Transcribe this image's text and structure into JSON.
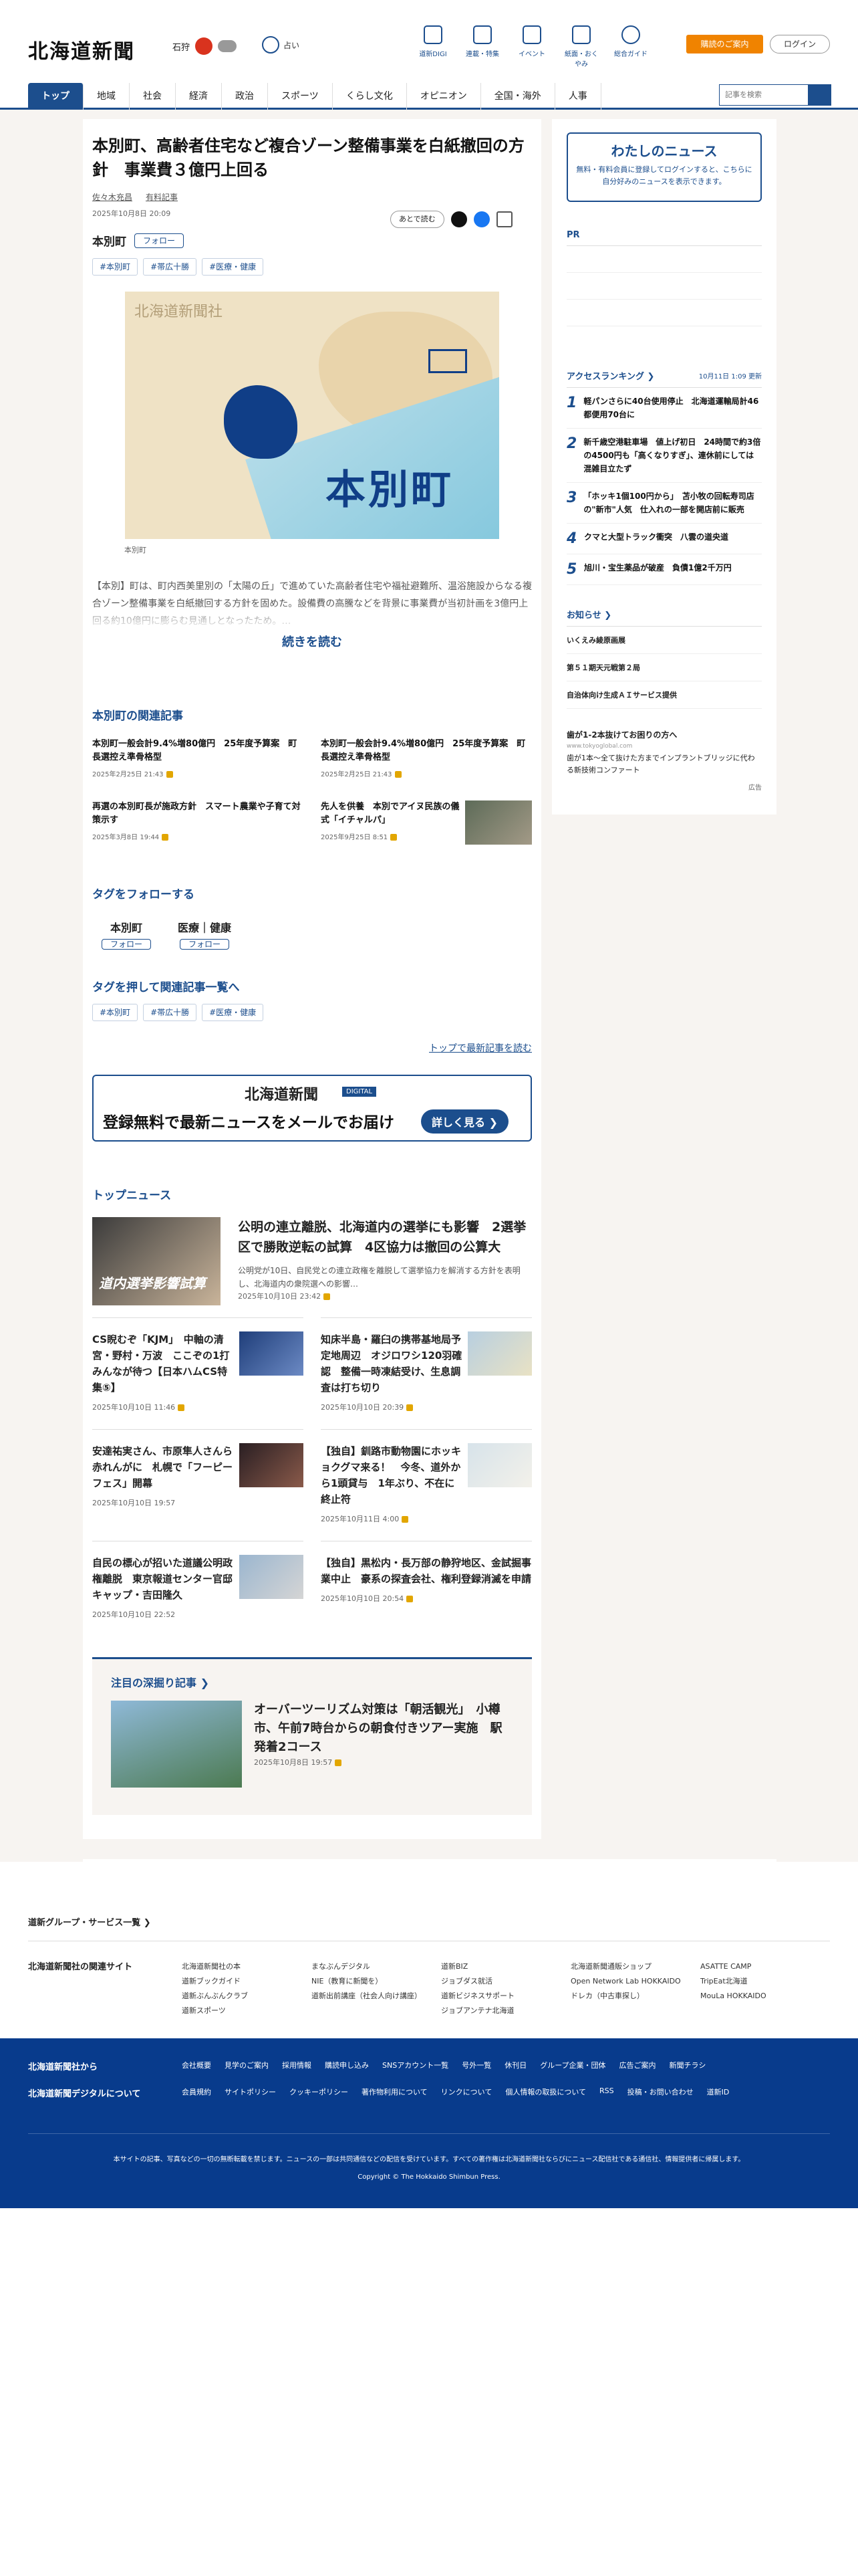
{
  "header": {
    "logo": "北海道新聞",
    "weather_city": "石狩",
    "fortune_label": "占い",
    "icons": [
      {
        "label": "道新DIGI"
      },
      {
        "label": "連載・特集"
      },
      {
        "label": "イベント"
      },
      {
        "label": "紙面・おくやみ"
      },
      {
        "label": "総合ガイド"
      }
    ],
    "guide_button": "購読のご案内",
    "login_button": "ログイン"
  },
  "nav": {
    "items": [
      "トップ",
      "地域",
      "社会",
      "経済",
      "政治",
      "スポーツ",
      "くらし文化",
      "オピニオン",
      "全国・海外",
      "人事"
    ],
    "search_placeholder": "記事を検索"
  },
  "article": {
    "title": "本別町、高齢者住宅など複合ゾーン整備事業を白紙撤回の方針　事業費３億円上回る",
    "author": "佐々木充昌",
    "badge": "有料記事",
    "date": "2025年10月8日 20:09",
    "later_button": "あとで読む",
    "place": "本別町",
    "follow": "フォロー",
    "tags": [
      "#本別町",
      "#帯広十勝",
      "#医療・健康"
    ],
    "map_logo": "北海道新聞社",
    "map_label": "本別町",
    "caption": "本別町",
    "summary": "【本別】町は、町内西美里別の「太陽の丘」で進めていた高齢者住宅や福祉避難所、温浴施設からなる複合ゾーン整備事業を白紙撤回する方針を固めた。設備費の高騰などを背景に事業費が当初計画を3億円上回る約10億円に膨らむ見通しとなったため。…",
    "read_more": "続きを読む"
  },
  "related": {
    "title": "本別町の関連記事",
    "items": [
      {
        "text": "本別町一般会計9.4%増80億円　25年度予算案　町長選控え準骨格型",
        "date": "2025年2月25日 21:43"
      },
      {
        "text": "本別町一般会計9.4%増80億円　25年度予算案　町長選控え準骨格型",
        "date": "2025年2月25日 21:43"
      },
      {
        "text": "再選の本別町長が施政方針　スマート農業や子育て対策示す",
        "date": "2025年3月8日 19:44"
      },
      {
        "text": "先人を供養　本別でアイヌ民族の儀式「イチャルパ」",
        "date": "2025年9月25日 8:51"
      }
    ]
  },
  "follow_tags": {
    "title": "タグをフォローする",
    "items": [
      {
        "name": "本別町",
        "button": "フォロー"
      },
      {
        "name": "医療｜健康",
        "button": "フォロー"
      }
    ]
  },
  "tag_list": {
    "title": "タグを押して関連記事一覧へ",
    "tags": [
      "#本別町",
      "#帯広十勝",
      "#医療・健康"
    ],
    "top_link": "トップで最新記事を読む"
  },
  "banner": {
    "logo": "北海道新聞",
    "digital": "DIGITAL",
    "text": "登録無料で最新ニュースをメールでお届け",
    "button": "詳しく見る ❯"
  },
  "top_news": {
    "title": "トップニュース",
    "lead": {
      "thumb_text": "道内選挙影響試算",
      "title": "公明の連立離脱、北海道内の選挙にも影響　2選挙区で勝敗逆転の試算　4区協力は撤回の公算大",
      "summary": "公明党が10日、自民党との連立政権を離脱して選挙協力を解消する方針を表明し、北海道内の衆院選への影響…",
      "date": "2025年10月10日 23:42"
    },
    "items": [
      {
        "text": "CS睨むぞ「KJM」　中軸の清宮・野村・万波　ここぞの1打みんなが待つ【日本ハムCS特集⑤】",
        "date": "2025年10月10日 11:46"
      },
      {
        "text": "知床半島・羅臼の携帯基地局予定地周辺　オジロワシ120羽確認　整備一時凍結受け、生息調査は打ち切り",
        "date": "2025年10月10日 20:39"
      },
      {
        "text": "安達祐実さん、市原隼人さんら赤れんがに　札幌で「フーピーフェス」開幕",
        "date": "2025年10月10日 19:57"
      },
      {
        "text": "【独自】釧路市動物園にホッキョクグマ来る！　今冬、道外から1頭貸与　1年ぶり、不在に終止符",
        "date": "2025年10月11日 4:00"
      },
      {
        "text": "自民の標心が招いた道議公明政権離脱　東京報道センター官邸キャップ・吉田隆久",
        "date": "2025年10月10日 22:52"
      },
      {
        "text": "【独自】黒松内・長万部の静狩地区、金試掘事業中止　豪系の探査会社、権利登録消滅を申請",
        "date": "2025年10月10日 20:54"
      }
    ]
  },
  "deep": {
    "title": "注目の深掘り記事 ❯",
    "article": "オーバーツーリズム対策は「朝活観光」　小樽市、午前7時台からの朝食付きツアー実施　駅発着2コース",
    "date": "2025年10月8日 19:57"
  },
  "sidebar": {
    "my_news_title": "わたしのニュース",
    "my_news_text": "無料・有料会員に登録してログインすると、こちらに自分好みのニュースを表示できます。",
    "pr": "PR",
    "ranking_title": "アクセスランキング ❯",
    "ranking_updated": "10月11日 1:09 更新",
    "ranking": [
      {
        "num": "1",
        "text": "軽パンさらに40台使用停止　北海道運輸局計46都便用70台に"
      },
      {
        "num": "2",
        "text": "新千歳空港駐車場　値上げ初日　24時間で約3倍の4500円も「高くなりすぎ」、連休前にしては混雑目立たず"
      },
      {
        "num": "3",
        "text": "「ホッキ1個100円から」　苫小牧の回転寿司店の\"新市\"人気　仕入れの一部を開店前に販売"
      },
      {
        "num": "4",
        "text": "クマと大型トラック衝突　八雲の道央道"
      },
      {
        "num": "5",
        "text": "旭川・宝生薬品が破産　負債1億2千万円"
      }
    ],
    "notice_title": "お知らせ ❯",
    "notices": [
      "いくえみ綾原画展",
      "第５１期天元戦第２局",
      "自治体向け生成ＡＩサービス提供"
    ],
    "ad_title": "歯が1-2本抜けてお困りの方へ",
    "ad_source": "www.tokyoglobal.com",
    "ad_text": "歯が1本〜全て抜けた方までインプラントブリッジに代わる新技術コンファート",
    "ad_label": "広告"
  },
  "footer": {
    "group_title": "道新グループ・サービス一覧 ❯",
    "sites_label": "北海道新聞社の関連サイト",
    "cols": [
      [
        "北海道新聞社の本",
        "道新ブックガイド",
        "道新ぶんぶんクラブ",
        "道新スポーツ"
      ],
      [
        "まなぶんデジタル",
        "NIE（教育に新聞を）",
        "道新出前講座（社会人向け講座）"
      ],
      [
        "道新BIZ",
        "ジョブダス就活",
        "道新ビジネスサポート",
        "ジョブアンテナ北海道"
      ],
      [
        "北海道新聞通販ショップ",
        "Open Network Lab HOKKAIDO",
        "ドレカ（中古車探し）"
      ],
      [
        "ASATTE CAMP",
        "TripEat北海道",
        "MouLa HOKKAIDO"
      ]
    ],
    "blue_label1": "北海道新聞社から",
    "blue_label2": "北海道新聞デジタルについて",
    "row1": [
      "会社概要",
      "見学のご案内",
      "採用情報",
      "購読申し込み",
      "SNSアカウント一覧",
      "号外一覧",
      "休刊日",
      "グループ企業・団体",
      "広告ご案内",
      "新聞チラシ"
    ],
    "row2": [
      "会員規約",
      "サイトポリシー",
      "クッキーポリシー",
      "著作物利用について",
      "リンクについて",
      "個人情報の取扱について",
      "RSS",
      "投稿・お問い合わせ",
      "道新ID"
    ],
    "copy1": "本サイトの記事、写真などの一切の無断転載を禁じます。ニュースの一部は共同通信などの配信を受けています。すべての著作権は北海道新聞社ならびにニュース配信社である通信社、情報提供者に帰属します。",
    "copy2": "Copyright © The Hokkaido Shimbun Press."
  }
}
